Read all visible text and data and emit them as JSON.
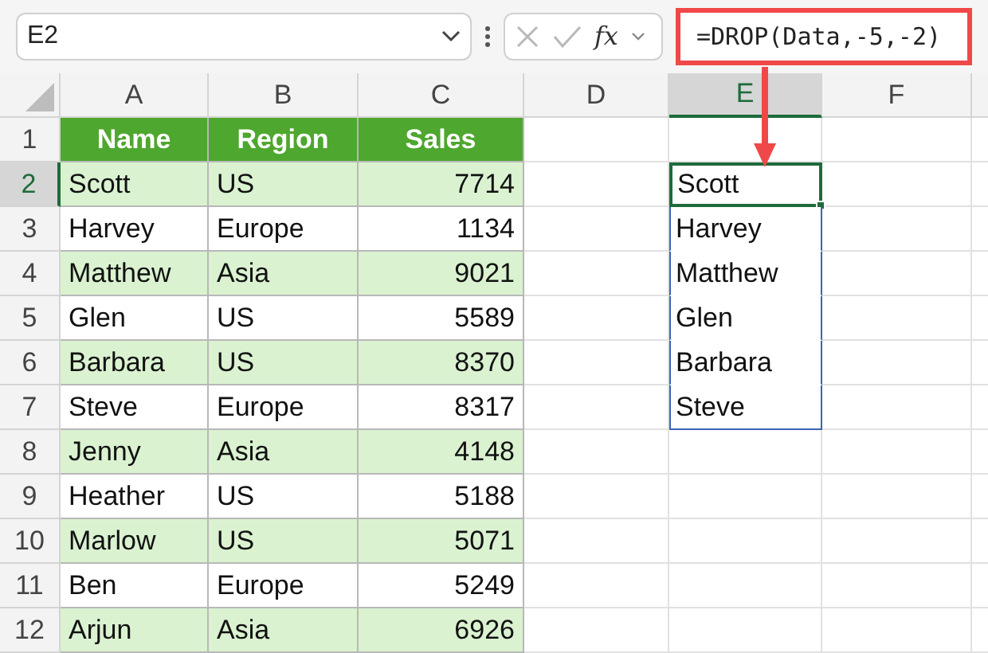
{
  "name_box": {
    "value": "E2"
  },
  "formula_bar": {
    "function_label": "fx",
    "formula": "=DROP(Data,-5,-2)",
    "highlighted": true
  },
  "column_headers": [
    {
      "label": "A",
      "selected": false
    },
    {
      "label": "B",
      "selected": false
    },
    {
      "label": "C",
      "selected": false
    },
    {
      "label": "D",
      "selected": false
    },
    {
      "label": "E",
      "selected": true
    },
    {
      "label": "F",
      "selected": false
    }
  ],
  "row_headers": [
    {
      "label": "1",
      "selected": false
    },
    {
      "label": "2",
      "selected": true
    },
    {
      "label": "3",
      "selected": false
    },
    {
      "label": "4",
      "selected": false
    },
    {
      "label": "5",
      "selected": false
    },
    {
      "label": "6",
      "selected": false
    },
    {
      "label": "7",
      "selected": false
    },
    {
      "label": "8",
      "selected": false
    },
    {
      "label": "9",
      "selected": false
    },
    {
      "label": "10",
      "selected": false
    },
    {
      "label": "11",
      "selected": false
    },
    {
      "label": "12",
      "selected": false
    }
  ],
  "data_table": {
    "columns": [
      "Name",
      "Region",
      "Sales"
    ],
    "rows": [
      [
        "Scott",
        "US",
        "7714"
      ],
      [
        "Harvey",
        "Europe",
        "1134"
      ],
      [
        "Matthew",
        "Asia",
        "9021"
      ],
      [
        "Glen",
        "US",
        "5589"
      ],
      [
        "Barbara",
        "US",
        "8370"
      ],
      [
        "Steve",
        "Europe",
        "8317"
      ],
      [
        "Jenny",
        "Asia",
        "4148"
      ],
      [
        "Heather",
        "US",
        "5188"
      ],
      [
        "Marlow",
        "US",
        "5071"
      ],
      [
        "Ben",
        "Europe",
        "5249"
      ],
      [
        "Arjun",
        "Asia",
        "6926"
      ]
    ]
  },
  "spill_result": [
    "Scott",
    "Harvey",
    "Matthew",
    "Glen",
    "Barbara",
    "Steve"
  ]
}
